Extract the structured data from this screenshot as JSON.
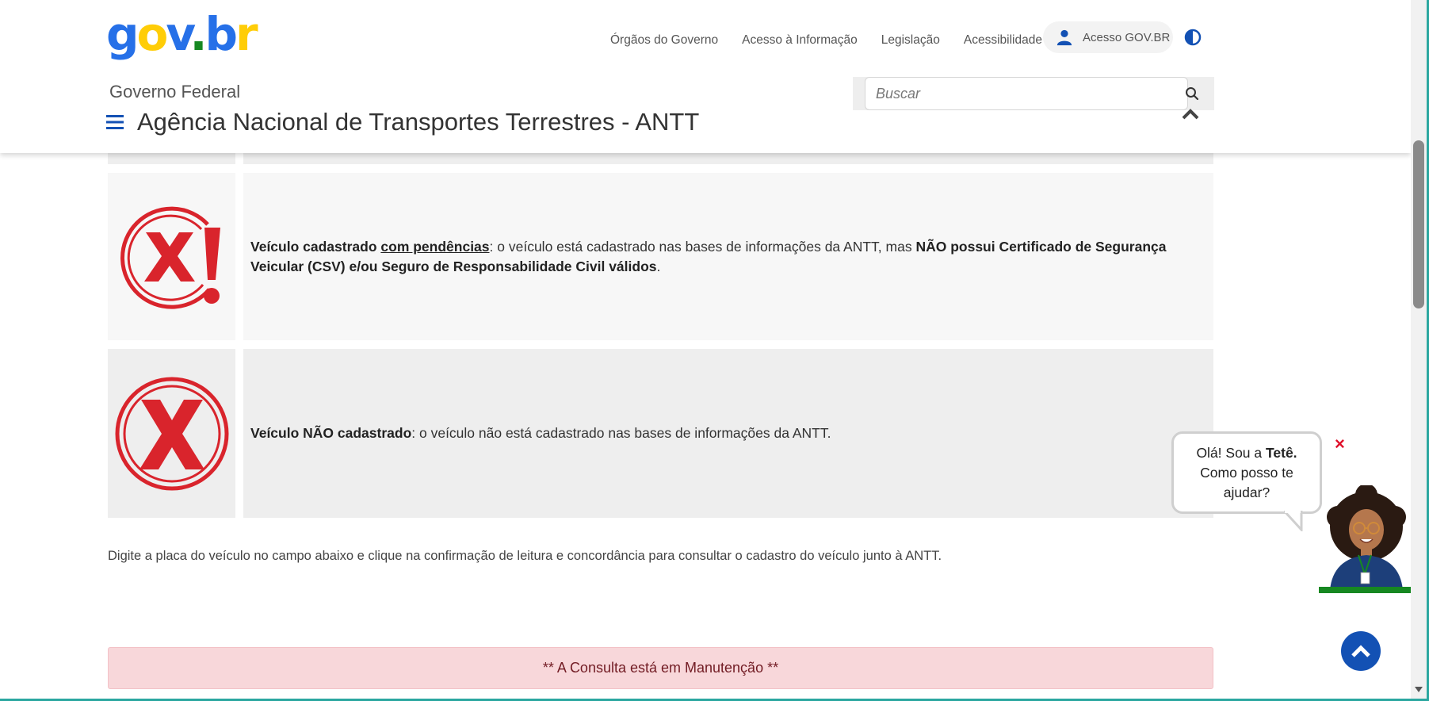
{
  "header": {
    "logo": {
      "g": "g",
      "o": "o",
      "v": "v",
      "dot": ".",
      "b": "b",
      "r": "r"
    },
    "nav": [
      {
        "label": "Órgãos do Governo"
      },
      {
        "label": "Acesso à Informação"
      },
      {
        "label": "Legislação"
      },
      {
        "label": "Acessibilidade"
      }
    ],
    "login_label": "Acesso GOV.BR",
    "gov_federal": "Governo Federal",
    "agency_title": "Agência Nacional de Transportes Terrestres - ANTT",
    "search": {
      "placeholder": "Buscar"
    }
  },
  "content": {
    "row1": {
      "title": "Veículo cadastrado",
      "link": "com pendências",
      "text": ": o veículo está cadastrado nas bases de informações da ANTT, mas ",
      "bold": "NÃO possui Certificado de Segurança Veicular (CSV) e/ou Seguro de Responsabilidade Civil válidos",
      "end": "."
    },
    "row2": {
      "title": "Veículo NÃO cadastrado",
      "text": ": o veículo não está cadastrado nas bases de informações da ANTT."
    },
    "instructions": "Digite a placa do veículo no campo abaixo e clique na confirmação de leitura e concordância para consultar o cadastro do veículo junto à ANTT.",
    "alert": "** A Consulta está em Manutenção **"
  },
  "chat": {
    "line1": "Olá! Sou a ",
    "name": "Tetê.",
    "line2": "Como posso te",
    "line3": "ajudar?",
    "close": "×"
  },
  "colors": {
    "primary_blue": "#1351b4",
    "logo_blue": "#2670e8",
    "logo_yellow": "#ffcd07",
    "logo_green": "#168821",
    "stamp_red": "#d9242c",
    "alert_bg": "#f8d7da",
    "alert_text": "#721c24"
  },
  "icons": [
    "user-icon",
    "contrast-icon",
    "menu-icon",
    "search-icon",
    "chevron-up-icon",
    "x-alert-stamp-icon",
    "x-stamp-icon",
    "close-icon",
    "chevron-up-icon",
    "scroll-down-arrow-icon"
  ]
}
